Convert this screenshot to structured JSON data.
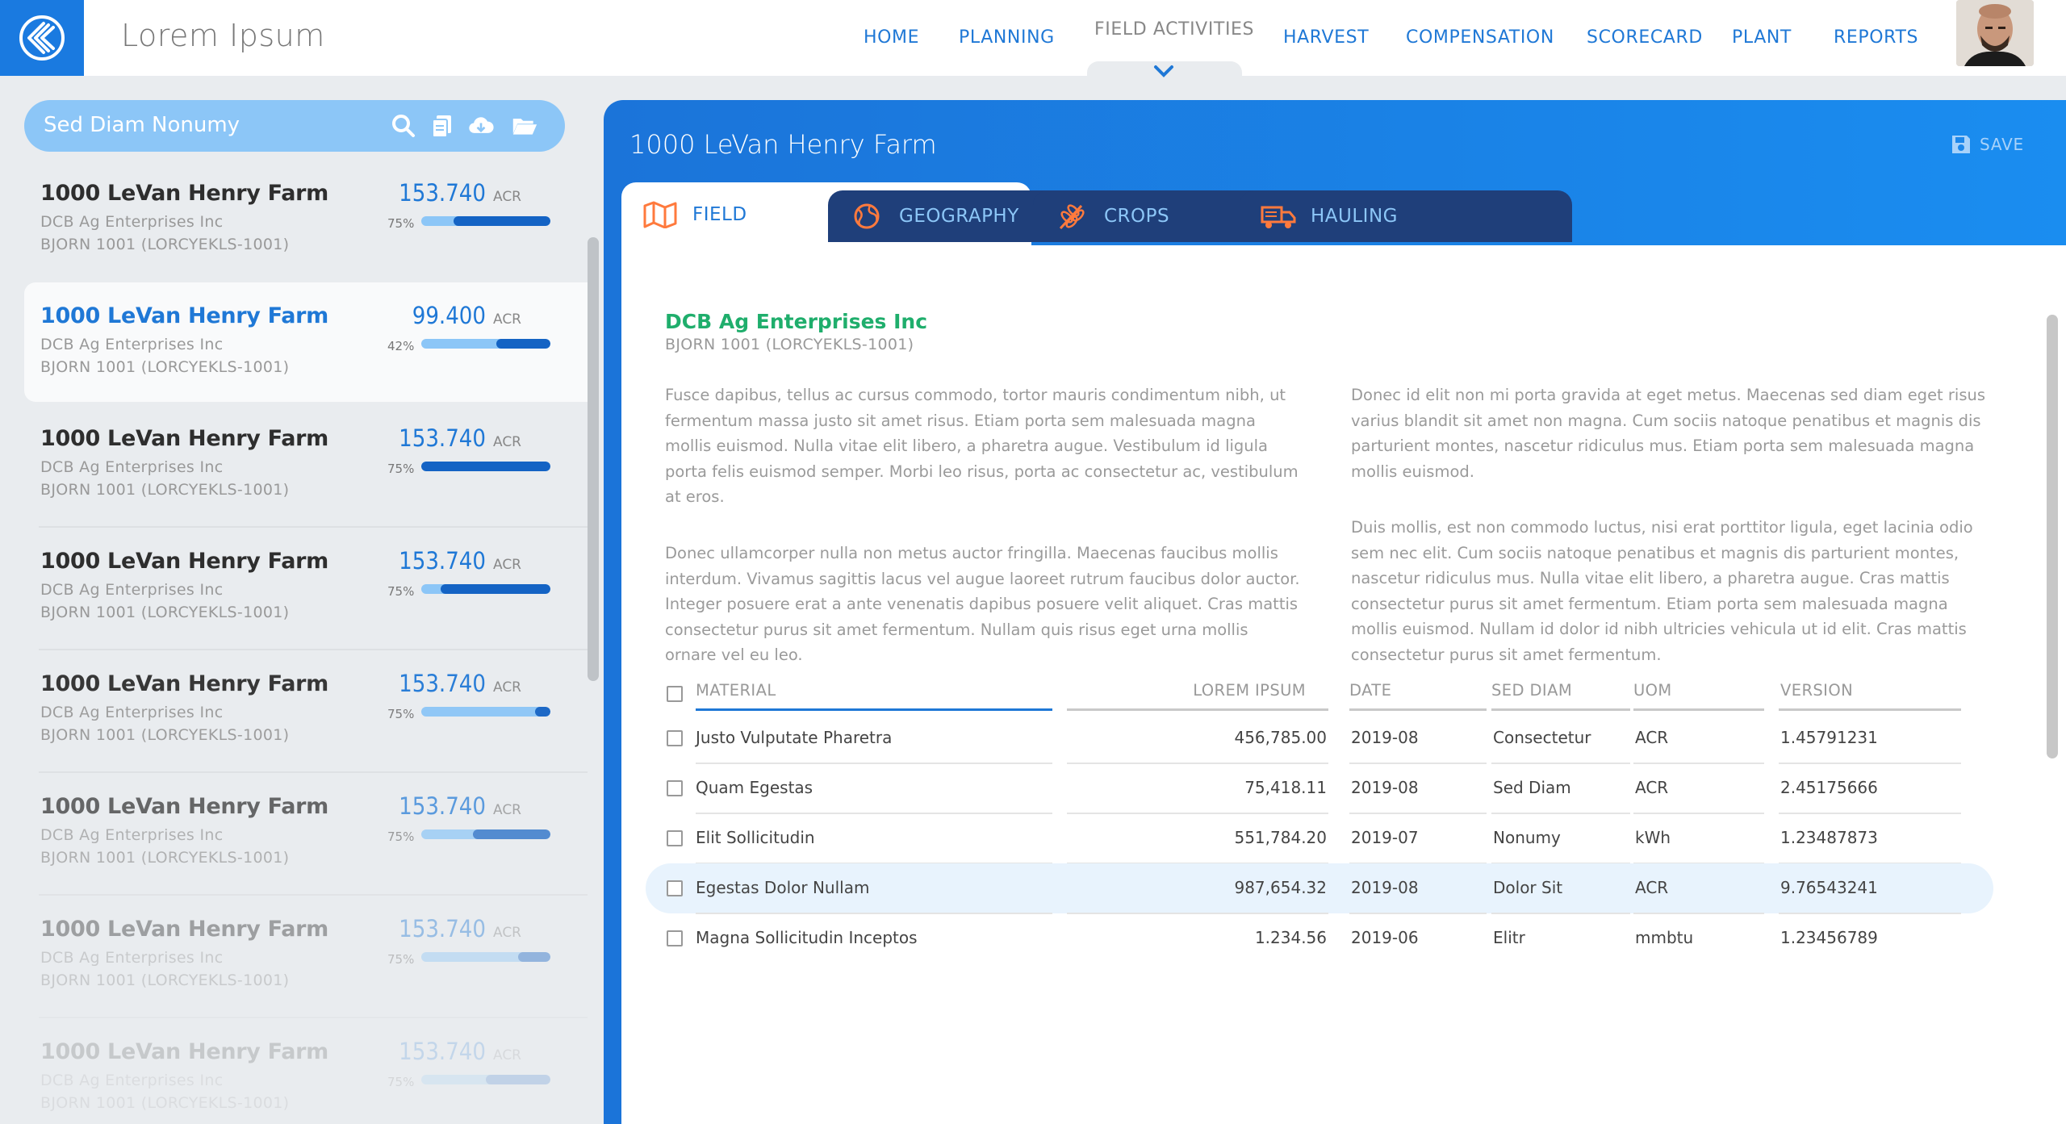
{
  "app": {
    "title": "Lorem Ipsum"
  },
  "nav": [
    {
      "label": "HOME",
      "active": false
    },
    {
      "label": "PLANNING",
      "active": false
    },
    {
      "label": "FIELD ACTIVITIES",
      "active": true
    },
    {
      "label": "HARVEST",
      "active": false
    },
    {
      "label": "COMPENSATION",
      "active": false
    },
    {
      "label": "SCORECARD",
      "active": false
    },
    {
      "label": "PLANT",
      "active": false
    },
    {
      "label": "REPORTS",
      "active": false
    }
  ],
  "sidebar": {
    "search_label": "Sed Diam Nonumy",
    "icons": [
      "search-icon",
      "copy-icon",
      "cloud-download-icon",
      "folder-open-icon"
    ],
    "items": [
      {
        "title": "1000 LeVan Henry Farm",
        "company": "DCB Ag Enterprises Inc",
        "code": "BJORN 1001 (LORCYEKLS-1001)",
        "value": "153.740",
        "unit": "ACR",
        "pct": "75%",
        "fill": 0.75,
        "selected": false,
        "opacity": 1
      },
      {
        "title": "1000 LeVan Henry Farm",
        "company": "DCB Ag Enterprises Inc",
        "code": "BJORN 1001 (LORCYEKLS-1001)",
        "value": "99.400",
        "unit": "ACR",
        "pct": "42%",
        "fill": 0.42,
        "selected": true,
        "opacity": 1
      },
      {
        "title": "1000 LeVan Henry Farm",
        "company": "DCB Ag Enterprises Inc",
        "code": "BJORN 1001 (LORCYEKLS-1001)",
        "value": "153.740",
        "unit": "ACR",
        "pct": "75%",
        "fill": 1.0,
        "selected": false,
        "opacity": 1
      },
      {
        "title": "1000 LeVan Henry Farm",
        "company": "DCB Ag Enterprises Inc",
        "code": "BJORN 1001 (LORCYEKLS-1001)",
        "value": "153.740",
        "unit": "ACR",
        "pct": "75%",
        "fill": 0.85,
        "selected": false,
        "opacity": 1
      },
      {
        "title": "1000 LeVan Henry Farm",
        "company": "DCB Ag Enterprises Inc",
        "code": "BJORN 1001 (LORCYEKLS-1001)",
        "value": "153.740",
        "unit": "ACR",
        "pct": "75%",
        "fill": 0.12,
        "selected": false,
        "opacity": 0.95
      },
      {
        "title": "1000 LeVan Henry Farm",
        "company": "DCB Ag Enterprises Inc",
        "code": "BJORN 1001 (LORCYEKLS-1001)",
        "value": "153.740",
        "unit": "ACR",
        "pct": "75%",
        "fill": 0.6,
        "selected": false,
        "opacity": 0.7
      },
      {
        "title": "1000 LeVan Henry Farm",
        "company": "DCB Ag Enterprises Inc",
        "code": "BJORN 1001 (LORCYEKLS-1001)",
        "value": "153.740",
        "unit": "ACR",
        "pct": "75%",
        "fill": 0.25,
        "selected": false,
        "opacity": 0.4
      },
      {
        "title": "1000 LeVan Henry Farm",
        "company": "DCB Ag Enterprises Inc",
        "code": "BJORN 1001 (LORCYEKLS-1001)",
        "value": "153.740",
        "unit": "ACR",
        "pct": "75%",
        "fill": 0.5,
        "selected": false,
        "opacity": 0.18
      }
    ]
  },
  "panel": {
    "title": "1000 LeVan Henry Farm",
    "save_label": "SAVE",
    "tabs": [
      {
        "label": "FIELD",
        "icon": "map-icon",
        "active": true
      },
      {
        "label": "GEOGRAPHY",
        "icon": "globe-icon",
        "active": false
      },
      {
        "label": "CROPS",
        "icon": "crop-icon",
        "active": false
      },
      {
        "label": "HAULING",
        "icon": "truck-icon",
        "active": false
      }
    ],
    "company": "DCB Ag Enterprises Inc",
    "company_code": "BJORN 1001 (LORCYEKLS-1001)",
    "paragraphs_left": [
      [
        "Fusce dapibus, tellus ac cursus commodo, tortor mauris condimentum nibh, ut",
        "fermentum massa justo sit amet risus. Etiam porta sem malesuada magna",
        "mollis euismod. Nulla vitae elit libero, a pharetra augue. Vestibulum id ligula",
        "porta felis euismod semper. Morbi leo risus, porta ac consectetur ac, vestibulum",
        "at eros."
      ],
      [
        "Donec ullamcorper nulla non metus auctor fringilla. Maecenas faucibus mollis",
        "interdum. Vivamus sagittis lacus vel augue laoreet rutrum faucibus dolor auctor.",
        "Integer posuere erat a ante venenatis dapibus posuere velit aliquet. Cras mattis",
        "consectetur purus sit amet fermentum. Nullam quis risus eget urna mollis",
        "ornare vel eu leo."
      ]
    ],
    "paragraphs_right": [
      [
        "Donec id elit non mi porta gravida at eget metus. Maecenas sed diam eget risus",
        "varius blandit sit amet non magna. Cum sociis natoque penatibus et magnis dis",
        "parturient montes, nascetur ridiculus mus. Etiam porta sem malesuada magna",
        "mollis euismod."
      ],
      [
        "Duis mollis, est non commodo luctus, nisi erat porttitor ligula, eget lacinia odio",
        "sem nec elit. Cum sociis natoque penatibus et magnis dis parturient montes,",
        "nascetur ridiculus mus. Nulla vitae elit libero, a pharetra augue. Cras mattis",
        "consectetur purus sit amet fermentum. Etiam porta sem malesuada magna",
        "mollis euismod. Nullam id dolor id nibh ultricies vehicula ut id elit. Cras mattis",
        "consectetur purus sit amet fermentum."
      ]
    ]
  },
  "table": {
    "headers": [
      "MATERIAL",
      "LOREM IPSUM",
      "DATE",
      "SED DIAM",
      "UOM",
      "VERSION"
    ],
    "rows": [
      {
        "material": "Justo Vulputate Pharetra",
        "amount": "456,785.00",
        "date": "2019-08",
        "sed": "Consectetur",
        "uom": "ACR",
        "version": "1.45791231",
        "highlight": false
      },
      {
        "material": "Quam Egestas",
        "amount": "75,418.11",
        "date": "2019-08",
        "sed": "Sed Diam",
        "uom": "ACR",
        "version": "2.45175666",
        "highlight": false
      },
      {
        "material": "Elit Sollicitudin",
        "amount": "551,784.20",
        "date": "2019-07",
        "sed": "Nonumy",
        "uom": "kWh",
        "version": "1.23487873",
        "highlight": false
      },
      {
        "material": "Egestas Dolor Nullam",
        "amount": "987,654.32",
        "date": "2019-08",
        "sed": "Dolor Sit",
        "uom": "ACR",
        "version": "9.76543241",
        "highlight": true
      },
      {
        "material": "Magna Sollicitudin Inceptos",
        "amount": "1.234.56",
        "date": "2019-06",
        "sed": "Elitr",
        "uom": "mmbtu",
        "version": "1.23456789",
        "highlight": false
      }
    ]
  },
  "colors": {
    "accent": "#1f78d6",
    "company": "#1fae6c",
    "tab_dark": "#1f3f7a",
    "tab_icon": "#ff7a3d"
  }
}
